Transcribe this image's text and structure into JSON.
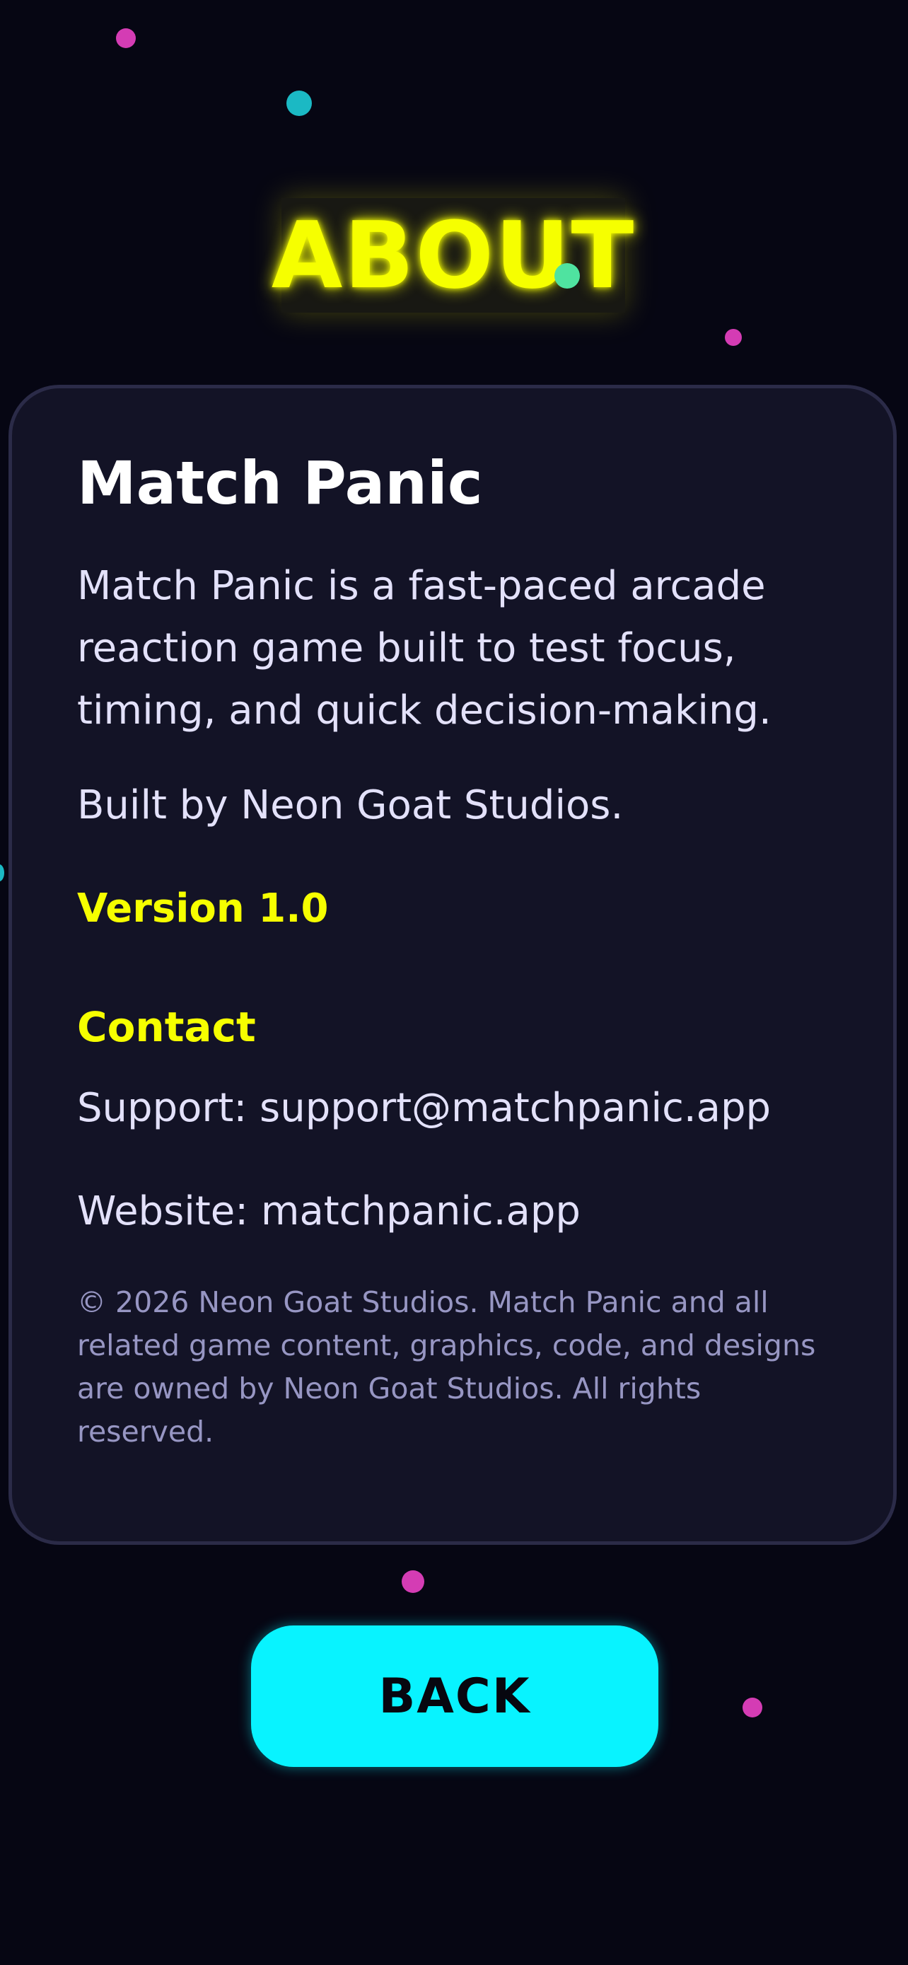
{
  "header": {
    "title": "ABOUT"
  },
  "about_card": {
    "game_name": "Match Panic",
    "description": "Match Panic is a fast-paced arcade reaction game built to test focus, timing, and quick decision-making.",
    "built_by": "Built by Neon Goat Studios.",
    "version": "Version 1.0",
    "contact": {
      "heading": "Contact",
      "support": "Support: support@matchpanic.app",
      "website": "Website: matchpanic.app"
    },
    "legal": "© 2026 Neon Goat Studios. Match Panic and all related game content, graphics, code, and designs are owned by Neon Goat Studios. All rights reserved."
  },
  "back_button": {
    "label": "BACK"
  },
  "colors": {
    "background": "#060613",
    "card": "#131326",
    "accent_yellow": "#f6ff00",
    "accent_cyan": "#08f3ff",
    "accent_magenta": "#d43cb4",
    "accent_mint": "#4fe3a0"
  }
}
